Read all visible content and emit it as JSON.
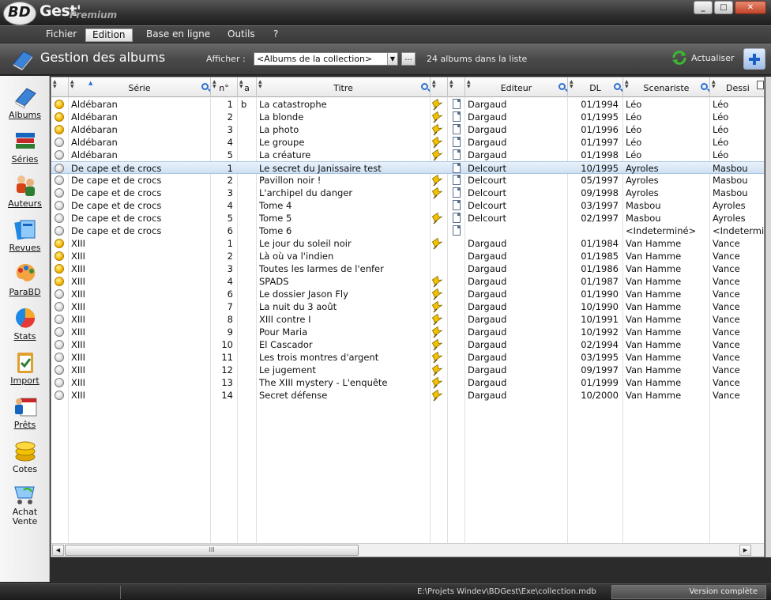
{
  "window": {
    "app_name": "Gest'",
    "logo_text": "BD",
    "edition": "Premium",
    "controls": [
      "_",
      "□",
      "✕"
    ]
  },
  "menu": [
    "Fichier",
    "Edition",
    "Base en ligne",
    "Outils",
    "?"
  ],
  "menu_active": "Edition",
  "toolbar": {
    "title": "Gestion des albums",
    "afficher_label": "Afficher :",
    "afficher_value": "<Albums de la collection>",
    "dots_label": "...",
    "count_text": "24 albums dans la liste",
    "refresh_label": "Actualiser"
  },
  "sidebar": [
    {
      "label": "Albums",
      "icon": "albums-book-icon",
      "underline": true
    },
    {
      "label": "Séries",
      "icon": "series-stack-icon",
      "underline": true
    },
    {
      "label": "Auteurs",
      "icon": "authors-people-icon",
      "underline": true
    },
    {
      "label": "Revues",
      "icon": "magazines-icon",
      "underline": true
    },
    {
      "label": "ParaBD",
      "icon": "palette-icon",
      "underline": true
    },
    {
      "label": "Stats",
      "icon": "pie-chart-icon",
      "underline": true
    },
    {
      "label": "Import",
      "icon": "clipboard-check-icon",
      "underline": true
    },
    {
      "label": "Prêts",
      "icon": "loans-calendar-icon",
      "underline": true
    },
    {
      "label": "Cotes",
      "icon": "coins-icon",
      "underline": false
    },
    {
      "label": "Achat\nVente",
      "icon": "shopping-cart-icon",
      "underline": false
    }
  ],
  "columns": [
    {
      "key": "status",
      "label": ""
    },
    {
      "key": "serie",
      "label": "Série"
    },
    {
      "key": "no",
      "label": "n°"
    },
    {
      "key": "a",
      "label": "a"
    },
    {
      "key": "titre",
      "label": "Titre"
    },
    {
      "key": "pin",
      "label": ""
    },
    {
      "key": "doc",
      "label": ""
    },
    {
      "key": "editeur",
      "label": "Editeur"
    },
    {
      "key": "dl",
      "label": "DL"
    },
    {
      "key": "scenariste",
      "label": "Scenariste"
    },
    {
      "key": "dessinateur",
      "label": "Dessi"
    }
  ],
  "rows": [
    {
      "status": "yellow",
      "serie": "Aldébaran",
      "no": "1",
      "a": "b",
      "titre": "La catastrophe",
      "pin": true,
      "doc": true,
      "editeur": "Dargaud",
      "dl": "01/1994",
      "scenariste": "Léo",
      "dessinateur": "Léo"
    },
    {
      "status": "yellow",
      "serie": "Aldébaran",
      "no": "2",
      "a": "",
      "titre": "La blonde",
      "pin": true,
      "doc": true,
      "editeur": "Dargaud",
      "dl": "01/1995",
      "scenariste": "Léo",
      "dessinateur": "Léo"
    },
    {
      "status": "yellow",
      "serie": "Aldébaran",
      "no": "3",
      "a": "",
      "titre": "La photo",
      "pin": true,
      "doc": true,
      "editeur": "Dargaud",
      "dl": "01/1996",
      "scenariste": "Léo",
      "dessinateur": "Léo"
    },
    {
      "status": "gray",
      "serie": "Aldébaran",
      "no": "4",
      "a": "",
      "titre": "Le groupe",
      "pin": true,
      "doc": true,
      "editeur": "Dargaud",
      "dl": "01/1997",
      "scenariste": "Léo",
      "dessinateur": "Léo"
    },
    {
      "status": "gray",
      "serie": "Aldébaran",
      "no": "5",
      "a": "",
      "titre": "La créature",
      "pin": true,
      "doc": true,
      "editeur": "Dargaud",
      "dl": "01/1998",
      "scenariste": "Léo",
      "dessinateur": "Léo"
    },
    {
      "status": "gray",
      "serie": "De cape et de crocs",
      "no": "1",
      "a": "",
      "titre": "Le secret du Janissaire test",
      "pin": false,
      "doc": true,
      "editeur": "Delcourt",
      "dl": "10/1995",
      "scenariste": "Ayroles",
      "dessinateur": "Masbou",
      "selected": true
    },
    {
      "status": "gray",
      "serie": "De cape et de crocs",
      "no": "2",
      "a": "",
      "titre": "Pavillon noir !",
      "pin": true,
      "doc": true,
      "editeur": "Delcourt",
      "dl": "05/1997",
      "scenariste": "Ayroles",
      "dessinateur": "Masbou"
    },
    {
      "status": "gray",
      "serie": "De cape et de crocs",
      "no": "3",
      "a": "",
      "titre": "L'archipel du danger",
      "pin": true,
      "doc": true,
      "editeur": "Delcourt",
      "dl": "09/1998",
      "scenariste": "Ayroles",
      "dessinateur": "Masbou"
    },
    {
      "status": "gray",
      "serie": "De cape et de crocs",
      "no": "4",
      "a": "",
      "titre": "Tome 4",
      "pin": false,
      "doc": true,
      "editeur": "Delcourt",
      "dl": "03/1997",
      "scenariste": "Masbou",
      "dessinateur": "Ayroles"
    },
    {
      "status": "gray",
      "serie": "De cape et de crocs",
      "no": "5",
      "a": "",
      "titre": "Tome 5",
      "pin": true,
      "doc": true,
      "editeur": "Delcourt",
      "dl": "02/1997",
      "scenariste": "Masbou",
      "dessinateur": "Ayroles"
    },
    {
      "status": "gray",
      "serie": "De cape et de crocs",
      "no": "6",
      "a": "",
      "titre": "Tome 6",
      "pin": false,
      "doc": true,
      "editeur": "",
      "dl": "",
      "scenariste": "<Indeterminé>",
      "dessinateur": "<Indeterminé>"
    },
    {
      "status": "yellow",
      "serie": "XIII",
      "no": "1",
      "a": "",
      "titre": "Le jour du soleil noir",
      "pin": true,
      "doc": false,
      "editeur": "Dargaud",
      "dl": "01/1984",
      "scenariste": "Van Hamme",
      "dessinateur": "Vance"
    },
    {
      "status": "yellow",
      "serie": "XIII",
      "no": "2",
      "a": "",
      "titre": "Là où va l'indien",
      "pin": false,
      "doc": false,
      "editeur": "Dargaud",
      "dl": "01/1985",
      "scenariste": "Van Hamme",
      "dessinateur": "Vance"
    },
    {
      "status": "yellow",
      "serie": "XIII",
      "no": "3",
      "a": "",
      "titre": "Toutes les larmes de l'enfer",
      "pin": false,
      "doc": false,
      "editeur": "Dargaud",
      "dl": "01/1986",
      "scenariste": "Van Hamme",
      "dessinateur": "Vance"
    },
    {
      "status": "yellow",
      "serie": "XIII",
      "no": "4",
      "a": "",
      "titre": "SPADS",
      "pin": true,
      "doc": false,
      "editeur": "Dargaud",
      "dl": "01/1987",
      "scenariste": "Van Hamme",
      "dessinateur": "Vance"
    },
    {
      "status": "gray",
      "serie": "XIII",
      "no": "6",
      "a": "",
      "titre": "Le dossier Jason Fly",
      "pin": true,
      "doc": false,
      "editeur": "Dargaud",
      "dl": "01/1990",
      "scenariste": "Van Hamme",
      "dessinateur": "Vance"
    },
    {
      "status": "gray",
      "serie": "XIII",
      "no": "7",
      "a": "",
      "titre": "La nuit du 3 août",
      "pin": true,
      "doc": false,
      "editeur": "Dargaud",
      "dl": "10/1990",
      "scenariste": "Van Hamme",
      "dessinateur": "Vance"
    },
    {
      "status": "gray",
      "serie": "XIII",
      "no": "8",
      "a": "",
      "titre": "XIII contre I",
      "pin": true,
      "doc": false,
      "editeur": "Dargaud",
      "dl": "10/1991",
      "scenariste": "Van Hamme",
      "dessinateur": "Vance"
    },
    {
      "status": "gray",
      "serie": "XIII",
      "no": "9",
      "a": "",
      "titre": "Pour Maria",
      "pin": true,
      "doc": false,
      "editeur": "Dargaud",
      "dl": "10/1992",
      "scenariste": "Van Hamme",
      "dessinateur": "Vance"
    },
    {
      "status": "gray",
      "serie": "XIII",
      "no": "10",
      "a": "",
      "titre": "El Cascador",
      "pin": true,
      "doc": false,
      "editeur": "Dargaud",
      "dl": "02/1994",
      "scenariste": "Van Hamme",
      "dessinateur": "Vance"
    },
    {
      "status": "gray",
      "serie": "XIII",
      "no": "11",
      "a": "",
      "titre": "Les trois montres d'argent",
      "pin": true,
      "doc": false,
      "editeur": "Dargaud",
      "dl": "03/1995",
      "scenariste": "Van Hamme",
      "dessinateur": "Vance"
    },
    {
      "status": "gray",
      "serie": "XIII",
      "no": "12",
      "a": "",
      "titre": "Le jugement",
      "pin": true,
      "doc": false,
      "editeur": "Dargaud",
      "dl": "09/1997",
      "scenariste": "Van Hamme",
      "dessinateur": "Vance"
    },
    {
      "status": "gray",
      "serie": "XIII",
      "no": "13",
      "a": "",
      "titre": "The XIII mystery - L'enquête",
      "pin": true,
      "doc": false,
      "editeur": "Dargaud",
      "dl": "01/1999",
      "scenariste": "Van Hamme",
      "dessinateur": "Vance"
    },
    {
      "status": "gray",
      "serie": "XIII",
      "no": "14",
      "a": "",
      "titre": "Secret défense",
      "pin": true,
      "doc": false,
      "editeur": "Dargaud",
      "dl": "10/2000",
      "scenariste": "Van Hamme",
      "dessinateur": "Vance"
    }
  ],
  "scrollbar": {
    "thumb_grip": "III",
    "left": "◀",
    "right": "▶"
  },
  "status": {
    "path": "E:\\Projets Windev\\BDGest\\Exe\\collection.mdb",
    "version": "Version complète"
  },
  "colors": {
    "accent": "#2d6fd0",
    "selected_row": "#cfe0f2",
    "status_owned": "#f2b400",
    "status_not_owned": "#dedede"
  }
}
